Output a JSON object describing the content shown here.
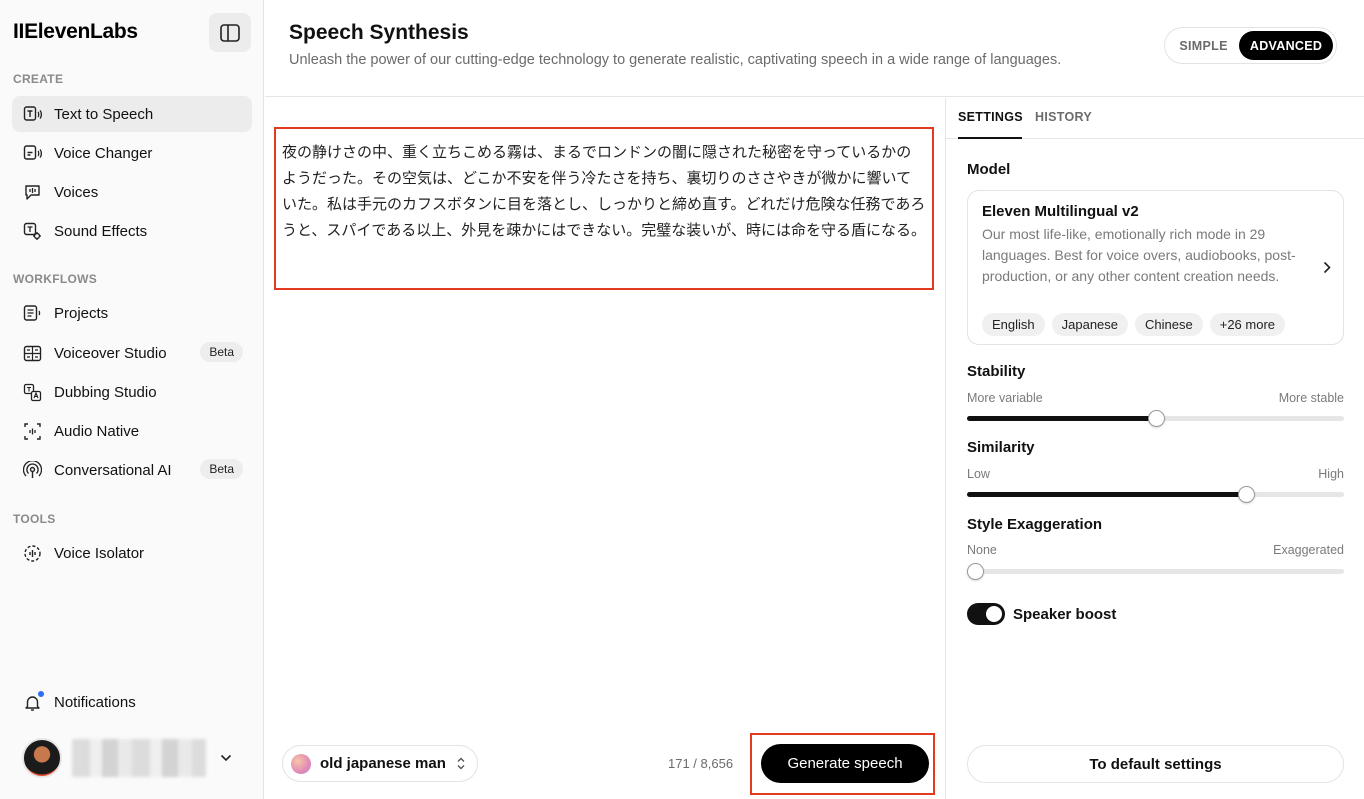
{
  "app": {
    "logo": "IIElevenLabs"
  },
  "sidebar": {
    "sections": {
      "create": "CREATE",
      "workflows": "WORKFLOWS",
      "tools": "TOOLS"
    },
    "items": [
      {
        "label": "Text to Speech",
        "icon": "text-to-speech-icon",
        "active": true
      },
      {
        "label": "Voice Changer",
        "icon": "voice-changer-icon"
      },
      {
        "label": "Voices",
        "icon": "voices-icon"
      },
      {
        "label": "Sound Effects",
        "icon": "sound-effects-icon"
      },
      {
        "label": "Projects",
        "icon": "projects-icon"
      },
      {
        "label": "Voiceover Studio",
        "icon": "voiceover-studio-icon",
        "badge": "Beta"
      },
      {
        "label": "Dubbing Studio",
        "icon": "dubbing-studio-icon"
      },
      {
        "label": "Audio Native",
        "icon": "audio-native-icon"
      },
      {
        "label": "Conversational AI",
        "icon": "conversational-ai-icon",
        "badge": "Beta"
      },
      {
        "label": "Voice Isolator",
        "icon": "voice-isolator-icon"
      }
    ],
    "notifications": "Notifications"
  },
  "header": {
    "title": "Speech Synthesis",
    "subtitle": "Unleash the power of our cutting-edge technology to generate realistic, captivating speech in a wide range of languages.",
    "mode": {
      "simple": "SIMPLE",
      "advanced": "ADVANCED",
      "selected": "ADVANCED"
    }
  },
  "editor": {
    "text": "夜の静けさの中、重く立ちこめる霧は、まるでロンドンの闇に隠された秘密を守っているかのようだった。その空気は、どこか不安を伴う冷たさを持ち、裏切りのささやきが微かに響いていた。私は手元のカフスボタンに目を落とし、しっかりと締め直す。どれだけ危険な任務であろうと、スパイである以上、外見を疎かにはできない。完璧な装いが、時には命を守る盾になる。",
    "voice": "old japanese man",
    "char_count": "171 / 8,656",
    "generate_label": "Generate speech"
  },
  "settings": {
    "tabs": {
      "settings": "SETTINGS",
      "history": "HISTORY",
      "active": "SETTINGS"
    },
    "model": {
      "label": "Model",
      "name": "Eleven Multilingual v2",
      "description": "Our most life-like, emotionally rich mode in 29 languages. Best for voice overs, audiobooks, post-production, or any other content creation needs.",
      "languages": [
        "English",
        "Japanese",
        "Chinese",
        "+26 more"
      ]
    },
    "stability": {
      "label": "Stability",
      "min_label": "More variable",
      "max_label": "More stable",
      "value": 0.5
    },
    "similarity": {
      "label": "Similarity",
      "min_label": "Low",
      "max_label": "High",
      "value": 0.74
    },
    "style": {
      "label": "Style Exaggeration",
      "min_label": "None",
      "max_label": "Exaggerated",
      "value": 0.02
    },
    "speaker_boost": {
      "label": "Speaker boost",
      "enabled": true
    },
    "default_label": "To default settings"
  }
}
